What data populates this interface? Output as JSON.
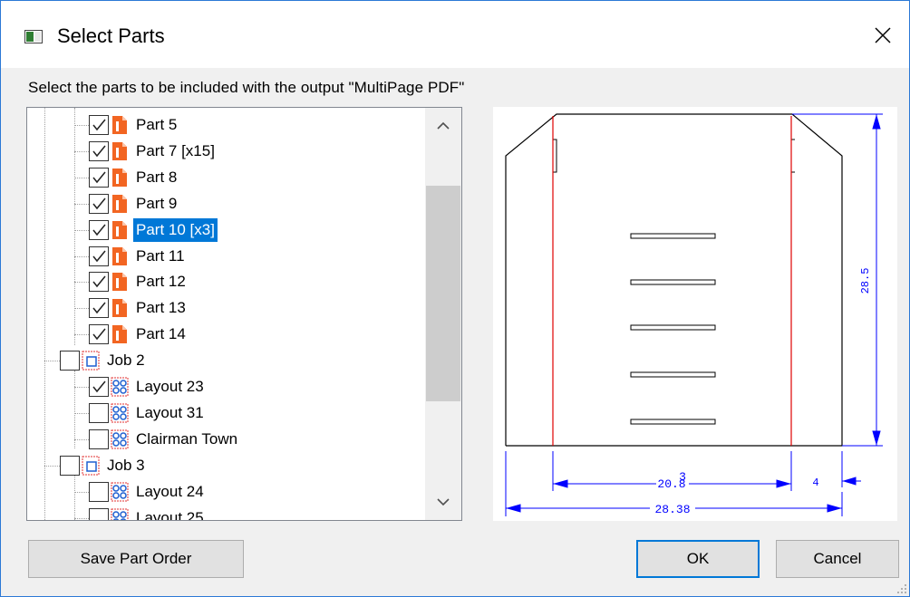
{
  "window": {
    "title": "Select Parts",
    "close_icon": "close-icon",
    "app_icon": "app-icon"
  },
  "instruction": "Select the parts to be included with the output \"MultiPage PDF\"",
  "tree": {
    "rows": [
      {
        "label": "Part 5",
        "checked": true,
        "icon": "part-icon",
        "level": 2
      },
      {
        "label": "Part 7 [x15]",
        "checked": true,
        "icon": "part-icon",
        "level": 2
      },
      {
        "label": "Part 8",
        "checked": true,
        "icon": "part-icon",
        "level": 2
      },
      {
        "label": "Part 9",
        "checked": true,
        "icon": "part-icon",
        "level": 2
      },
      {
        "label": "Part 10 [x3]",
        "checked": true,
        "icon": "part-icon",
        "level": 2,
        "selected": true
      },
      {
        "label": "Part 11",
        "checked": true,
        "icon": "part-icon",
        "level": 2
      },
      {
        "label": "Part 12",
        "checked": true,
        "icon": "part-icon",
        "level": 2
      },
      {
        "label": "Part 13",
        "checked": true,
        "icon": "part-icon",
        "level": 2
      },
      {
        "label": "Part 14",
        "checked": true,
        "icon": "part-icon",
        "level": 2
      },
      {
        "label": "Job 2",
        "checked": false,
        "icon": "job-icon",
        "level": 1
      },
      {
        "label": "Layout 23",
        "checked": true,
        "icon": "layout-icon",
        "level": 2
      },
      {
        "label": "Layout 31",
        "checked": false,
        "icon": "layout-icon",
        "level": 2
      },
      {
        "label": "Clairman Town",
        "checked": false,
        "icon": "layout-icon",
        "level": 2
      },
      {
        "label": "Job 3",
        "checked": false,
        "icon": "job-icon",
        "level": 1
      },
      {
        "label": "Layout 24",
        "checked": false,
        "icon": "layout-icon",
        "level": 2
      },
      {
        "label": "Layout 25",
        "checked": false,
        "icon": "layout-icon",
        "level": 2
      }
    ],
    "scroll_up_icon": "chevron-up-icon",
    "scroll_down_icon": "chevron-down-icon"
  },
  "preview": {
    "dimensions": {
      "height": "28.5",
      "inner_width": "20.8",
      "inner_width_overlap": "3",
      "offset": "4",
      "total_width": "28.38"
    },
    "colors": {
      "outline": "#000000",
      "fold_lines": "#e00000",
      "dimension": "#0000ff"
    }
  },
  "buttons": {
    "save_order": "Save Part Order",
    "ok": "OK",
    "cancel": "Cancel"
  },
  "colors": {
    "selection": "#0078d7",
    "window_border": "#2b79d6",
    "part_icon": "#f26522",
    "layout_icon": "#1e5fd0"
  }
}
